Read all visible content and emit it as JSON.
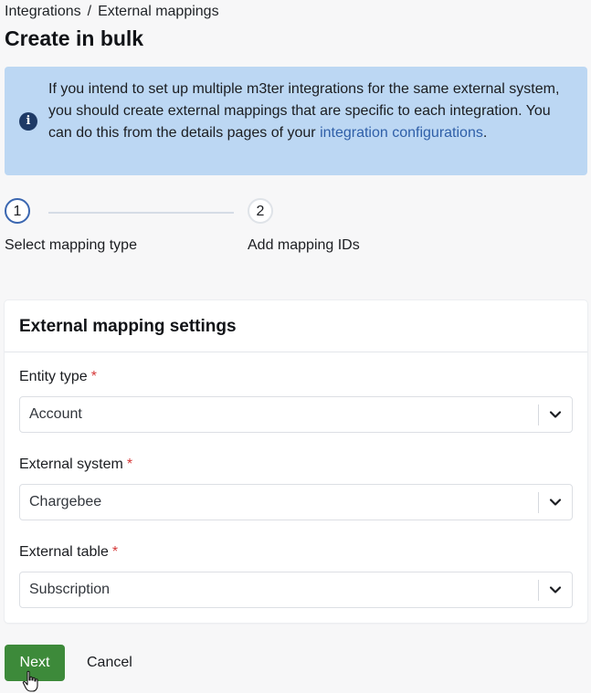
{
  "breadcrumb": {
    "parent": "Integrations",
    "separator": "/",
    "current": "External mappings"
  },
  "page": {
    "title": "Create in bulk"
  },
  "info": {
    "text": "If you intend to set up multiple m3ter integrations for the same external system, you should create external mappings that are specific to each integration. You can do this from the details pages of your",
    "link": "integration configurations",
    "suffix": "."
  },
  "stepper": {
    "steps": [
      {
        "number": "1",
        "label": "Select mapping type"
      },
      {
        "number": "2",
        "label": "Add mapping IDs"
      }
    ]
  },
  "card": {
    "title": "External mapping settings",
    "fields": [
      {
        "label": "Entity type",
        "required": "*",
        "value": "Account"
      },
      {
        "label": "External system",
        "required": "*",
        "value": "Chargebee"
      },
      {
        "label": "External table",
        "required": "*",
        "value": "Subscription"
      }
    ]
  },
  "actions": {
    "next": "Next",
    "cancel": "Cancel"
  },
  "colors": {
    "primary": "#3d8a3a",
    "info_bg": "#bcd7f3",
    "link": "#2f5fa8",
    "required": "#d63a3a"
  }
}
